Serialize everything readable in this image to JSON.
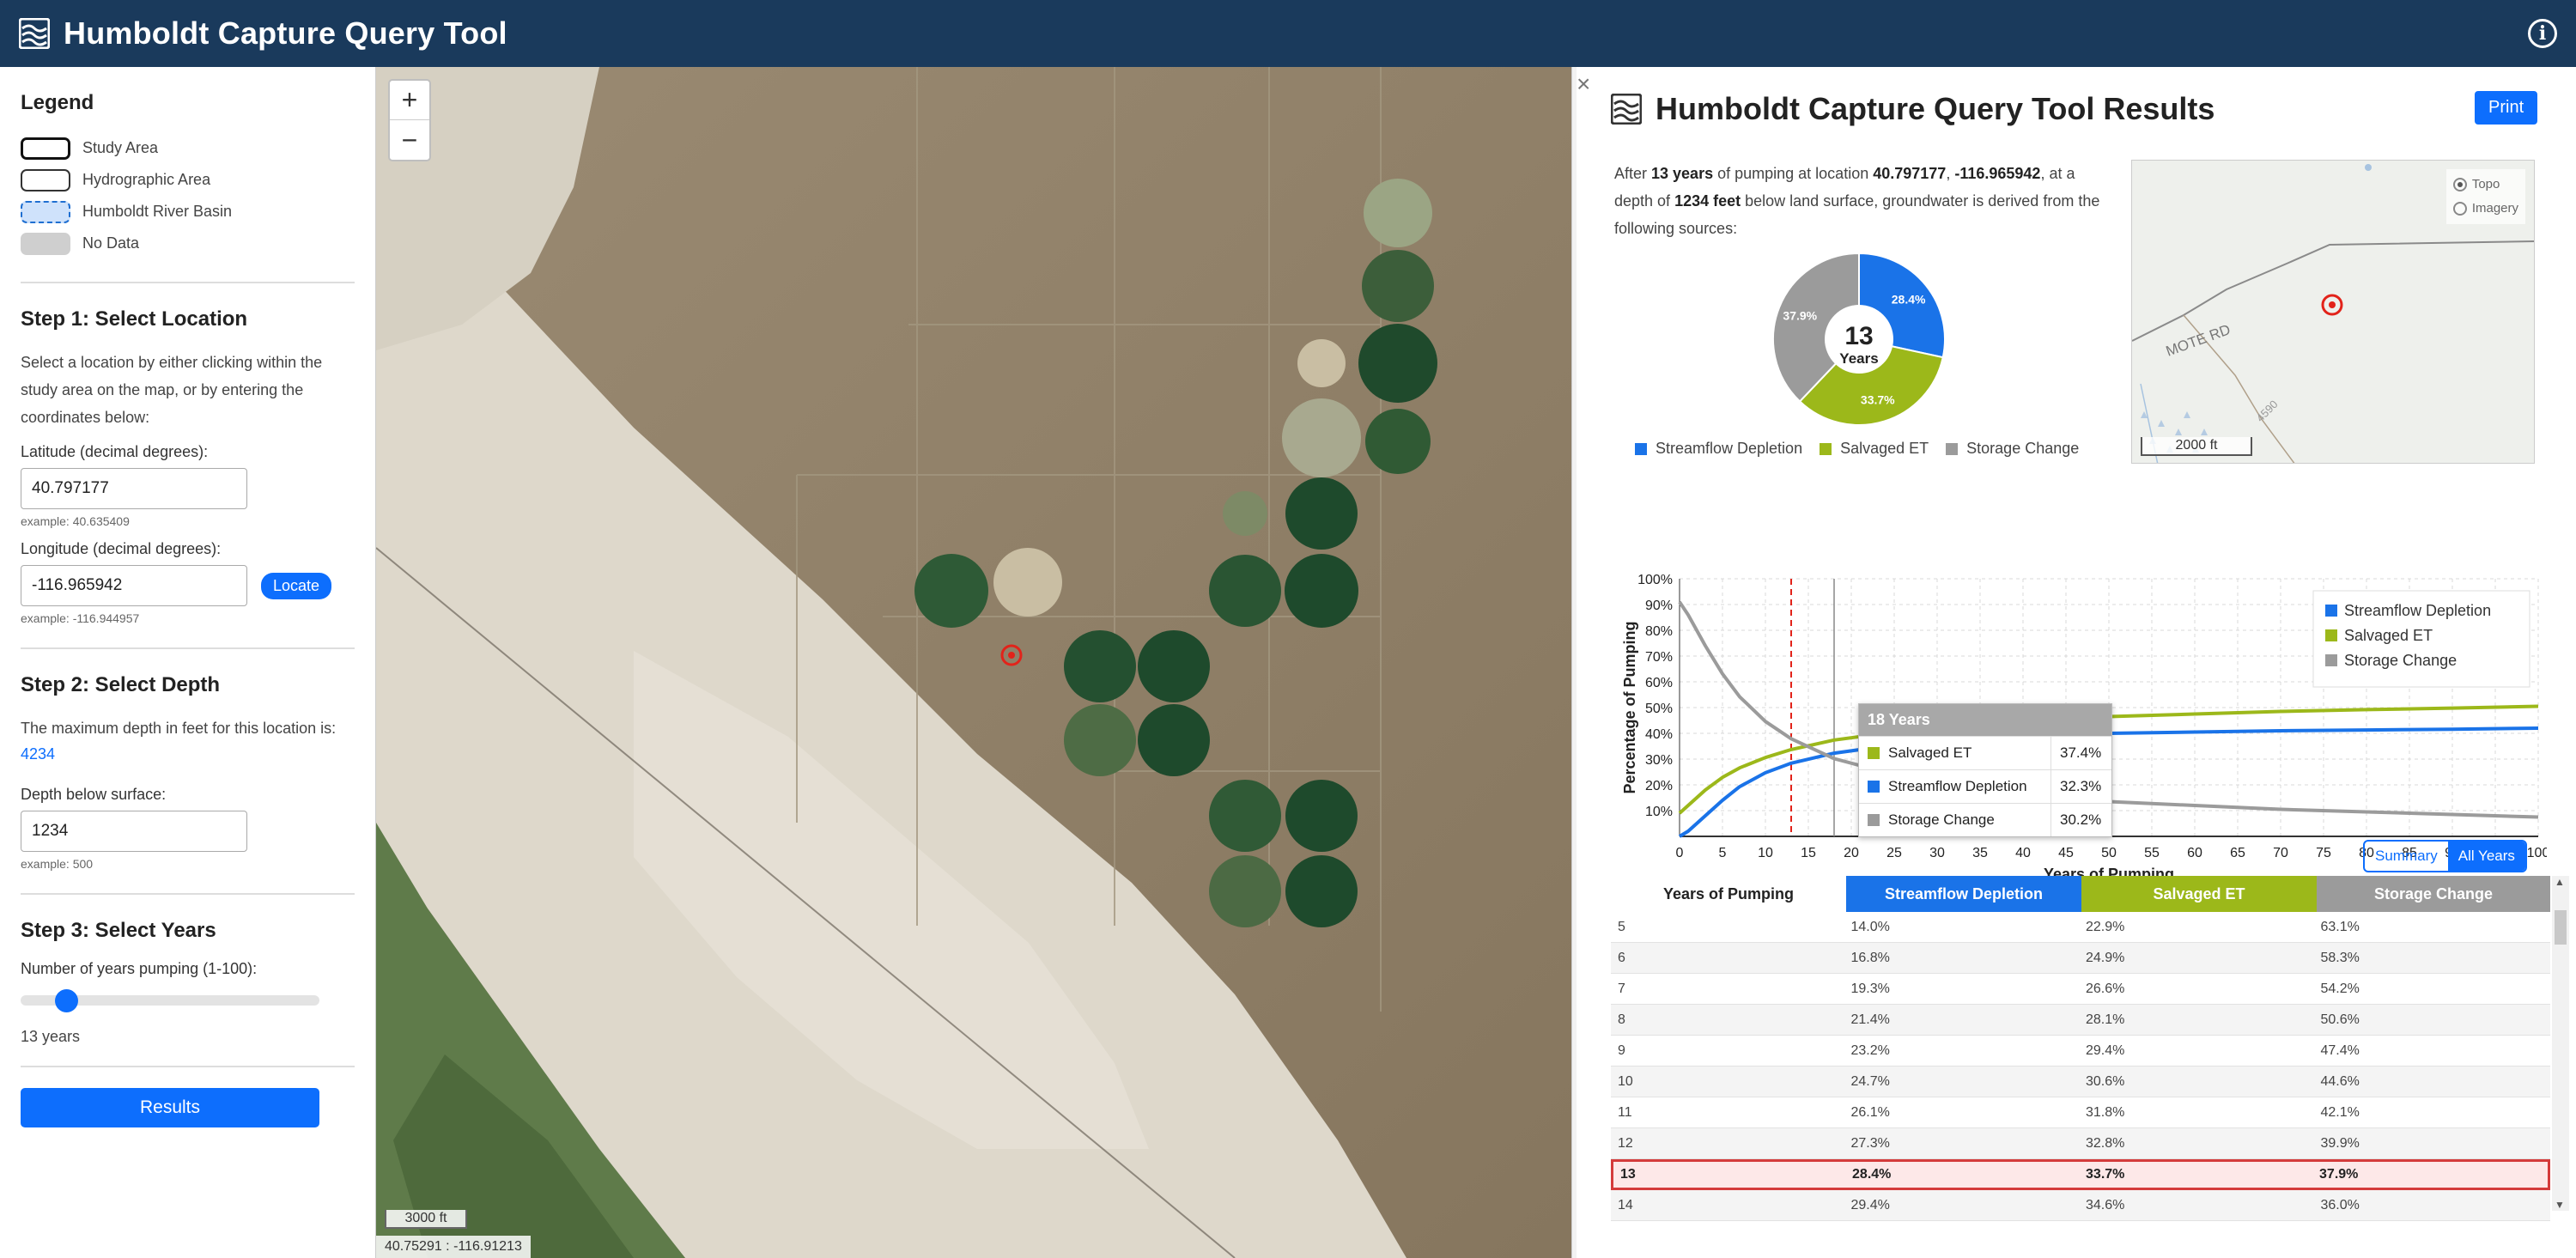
{
  "header": {
    "title": "Humboldt Capture Query Tool",
    "info_icon": "info-icon"
  },
  "legend": {
    "heading": "Legend",
    "items": [
      "Study Area",
      "Hydrographic Area",
      "Humboldt River Basin",
      "No Data"
    ]
  },
  "step1": {
    "heading": "Step 1: Select Location",
    "description": "Select a location by either clicking within the study area on the map, or by entering the coordinates below:",
    "lat_label": "Latitude (decimal degrees):",
    "lat_value": "40.797177",
    "lat_example": "example: 40.635409",
    "lon_label": "Longitude (decimal degrees):",
    "lon_value": "-116.965942",
    "lon_example": "example: -116.944957",
    "locate_label": "Locate"
  },
  "step2": {
    "heading": "Step 2: Select Depth",
    "description": "The maximum depth in feet for this location is:",
    "max_depth": "4234",
    "depth_label": "Depth below surface:",
    "depth_value": "1234",
    "depth_example": "example: 500"
  },
  "step3": {
    "heading": "Step 3: Select Years",
    "slider_label": "Number of years pumping (1-100):",
    "slider_value": 13,
    "years_text": "13 years"
  },
  "results_button": "Results",
  "map": {
    "zoom_in": "+",
    "zoom_out": "−",
    "scale": "3000 ft",
    "coords": "40.75291 : -116.91213"
  },
  "results": {
    "close": "×",
    "title": "Humboldt Capture Query Tool Results",
    "print_label": "Print",
    "summary": {
      "p1": "After ",
      "years": "13 years",
      "p2": " of pumping at location ",
      "lat": "40.797177",
      "sep": ", ",
      "lon": "-116.965942",
      "p3": ", at a depth of ",
      "depth": "1234 feet",
      "p4": " below land surface, groundwater is derived from the following sources:"
    },
    "pie": {
      "center_value": "13",
      "center_label": "Years",
      "slices": [
        {
          "name": "Streamflow Depletion",
          "value": 28.4,
          "label": "28.4%",
          "color": "#1a73e8"
        },
        {
          "name": "Salvaged ET",
          "value": 33.7,
          "label": "33.7%",
          "color": "#9cb81a"
        },
        {
          "name": "Storage Change",
          "value": 37.9,
          "label": "37.9%",
          "color": "#9b9b9b"
        }
      ]
    },
    "minimap": {
      "topo": "Topo",
      "imagery": "Imagery",
      "road": "MOTE RD",
      "route": "4590",
      "scale": "2000 ft"
    },
    "tooltip": {
      "title": "18 Years",
      "rows": [
        {
          "name": "Salvaged ET",
          "value": "37.4%",
          "color": "#9cb81a"
        },
        {
          "name": "Streamflow Depletion",
          "value": "32.3%",
          "color": "#1a73e8"
        },
        {
          "name": "Storage Change",
          "value": "30.2%",
          "color": "#9b9b9b"
        }
      ]
    },
    "toggle": {
      "summary": "Summary",
      "all_years": "All Years"
    },
    "table": {
      "headers": [
        "Years of Pumping",
        "Streamflow Depletion",
        "Salvaged ET",
        "Storage Change"
      ],
      "rows": [
        [
          "5",
          "14.0%",
          "22.9%",
          "63.1%"
        ],
        [
          "6",
          "16.8%",
          "24.9%",
          "58.3%"
        ],
        [
          "7",
          "19.3%",
          "26.6%",
          "54.2%"
        ],
        [
          "8",
          "21.4%",
          "28.1%",
          "50.6%"
        ],
        [
          "9",
          "23.2%",
          "29.4%",
          "47.4%"
        ],
        [
          "10",
          "24.7%",
          "30.6%",
          "44.6%"
        ],
        [
          "11",
          "26.1%",
          "31.8%",
          "42.1%"
        ],
        [
          "12",
          "27.3%",
          "32.8%",
          "39.9%"
        ],
        [
          "13",
          "28.4%",
          "33.7%",
          "37.9%"
        ],
        [
          "14",
          "29.4%",
          "34.6%",
          "36.0%"
        ]
      ],
      "highlight_year": "13"
    }
  },
  "chart_data": {
    "type": "line",
    "title": "",
    "xlabel": "Years of Pumping",
    "ylabel": "Percentage of Pumping",
    "xlim": [
      0,
      100
    ],
    "ylim": [
      0,
      100
    ],
    "x_ticks": [
      0,
      5,
      10,
      15,
      20,
      25,
      30,
      35,
      40,
      45,
      50,
      55,
      60,
      65,
      70,
      75,
      80,
      85,
      90,
      95,
      100
    ],
    "y_ticks": [
      "10%",
      "20%",
      "30%",
      "40%",
      "50%",
      "60%",
      "70%",
      "80%",
      "90%",
      "100%"
    ],
    "grid": true,
    "legend_position": "top-right",
    "selected_year": 13,
    "hover_year": 18,
    "x": [
      0,
      1,
      2,
      3,
      5,
      7,
      10,
      13,
      18,
      25,
      30,
      40,
      50,
      60,
      70,
      80,
      90,
      100
    ],
    "series": [
      {
        "name": "Streamflow Depletion",
        "color": "#1a73e8",
        "values": [
          0,
          2,
          5,
          8,
          14,
          19.3,
          24.7,
          28.4,
          32.3,
          35.5,
          37,
          39,
          40,
          40.5,
          41,
          41.3,
          41.6,
          42
        ]
      },
      {
        "name": "Salvaged ET",
        "color": "#9cb81a",
        "values": [
          9,
          12,
          15,
          18,
          22.9,
          26.6,
          30.6,
          33.7,
          37.4,
          40.5,
          42.5,
          45,
          46.5,
          47.5,
          48.5,
          49.2,
          49.8,
          50.5
        ]
      },
      {
        "name": "Storage Change",
        "color": "#9b9b9b",
        "values": [
          91,
          86,
          80,
          74,
          63.1,
          54.2,
          44.6,
          37.9,
          30.2,
          24,
          20.5,
          16,
          13.5,
          12,
          10.5,
          9.5,
          8.5,
          7.5
        ]
      }
    ]
  }
}
